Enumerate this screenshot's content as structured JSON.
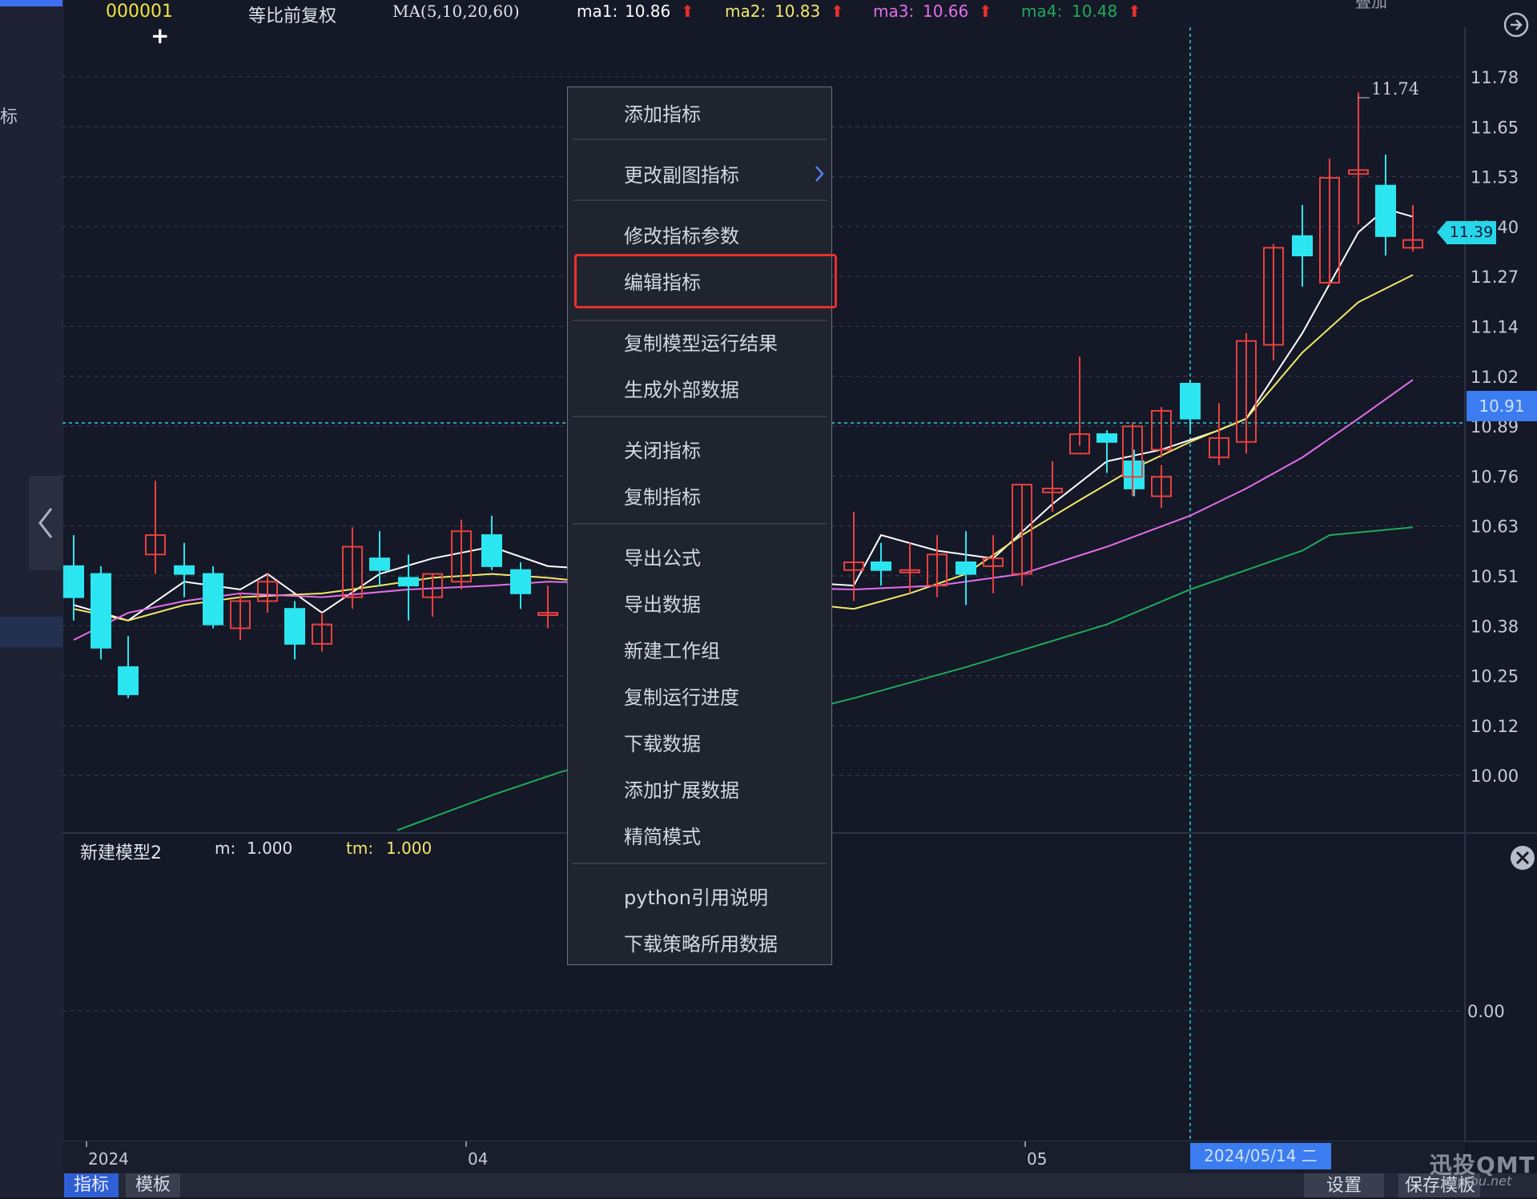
{
  "header": {
    "code": "000001",
    "adjust_mode": "等比前复权",
    "ma_name": "MA(5,10,20,60)",
    "ma1_label": "ma1:",
    "ma1_value": "10.86",
    "ma2_label": "ma2:",
    "ma2_value": "10.83",
    "ma3_label": "ma3:",
    "ma3_value": "10.66",
    "ma4_label": "ma4:",
    "ma4_value": "10.48",
    "arrow": "⬆",
    "overlay_label": "叠加"
  },
  "left_panel": {
    "partial_label": "标"
  },
  "price_axis": {
    "labels": [
      "11.78",
      "11.65",
      "11.53",
      "11.40",
      "11.27",
      "11.14",
      "11.02",
      "10.89",
      "10.76",
      "10.63",
      "10.51",
      "10.38",
      "10.25",
      "10.12",
      "10.00"
    ],
    "current_price": "10.91",
    "last_price": "11.39",
    "high_label": "11.74"
  },
  "sub_chart": {
    "name": "新建模型2",
    "m_label": "m:",
    "m_value": "1.000",
    "tm_label": "tm:",
    "tm_value": "1.000",
    "zero_label": "0.00"
  },
  "time_axis": {
    "labels": [
      "2024",
      "04",
      "05"
    ],
    "crosshair_date": "2024/05/14 二"
  },
  "bottom_tabs": {
    "indicator": "指标",
    "template": "模板",
    "settings": "设置",
    "save_template": "保存模板"
  },
  "context_menu": {
    "items": [
      "添加指标",
      "更改副图指标",
      "修改指标参数",
      "编辑指标",
      "复制模型运行结果",
      "生成外部数据",
      "关闭指标",
      "复制指标",
      "导出公式",
      "导出数据",
      "新建工作组",
      "复制运行进度",
      "下载数据",
      "添加扩展数据",
      "精简模式",
      "python引用说明",
      "下载策略所用数据"
    ],
    "highlighted_index": 3
  },
  "watermark": {
    "brand": "迅投QMT",
    "url": "xuntou.net"
  },
  "colors": {
    "background": "#141827",
    "up_candle": "#e8413f",
    "down_candle": "#2be6f0",
    "ma1": "#ffffff",
    "ma2": "#f2e86a",
    "ma3": "#e46ee8",
    "ma4": "#1faa5a",
    "accent_blue": "#3b7cf0",
    "highlight_red": "#e8302c"
  }
}
